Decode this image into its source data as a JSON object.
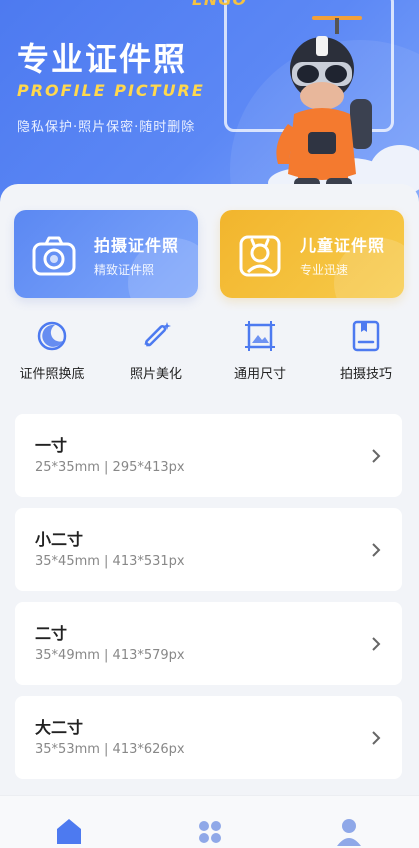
{
  "hero": {
    "corner_text": "ENGO",
    "title": "专业证件照",
    "subtitle_en": "PROFILE PICTURE",
    "tagline": "隐私保护·照片保密·随时删除"
  },
  "features": [
    {
      "title": "拍摄证件照",
      "subtitle": "精致证件照",
      "icon": "camera-icon",
      "color": "#5b88f2"
    },
    {
      "title": "儿童证件照",
      "subtitle": "专业迅速",
      "icon": "child-portrait-icon",
      "color": "#f2b52d"
    }
  ],
  "tools": [
    {
      "label": "证件照换底",
      "icon": "moon-icon"
    },
    {
      "label": "照片美化",
      "icon": "magic-wand-icon"
    },
    {
      "label": "通用尺寸",
      "icon": "size-frame-icon"
    },
    {
      "label": "拍摄技巧",
      "icon": "tips-book-icon"
    }
  ],
  "sizes": [
    {
      "name": "一寸",
      "dims": "25*35mm | 295*413px"
    },
    {
      "name": "小二寸",
      "dims": "35*45mm | 413*531px"
    },
    {
      "name": "二寸",
      "dims": "35*49mm | 413*579px"
    },
    {
      "name": "大二寸",
      "dims": "35*53mm | 413*626px"
    }
  ],
  "nav": [
    {
      "icon": "home-icon",
      "active": true
    },
    {
      "icon": "grid-icon",
      "active": false
    },
    {
      "icon": "user-icon",
      "active": false
    }
  ],
  "colors": {
    "accent": "#4d7af0",
    "yellow": "#f2b52d",
    "nav_inactive": "#8fa8e8"
  }
}
